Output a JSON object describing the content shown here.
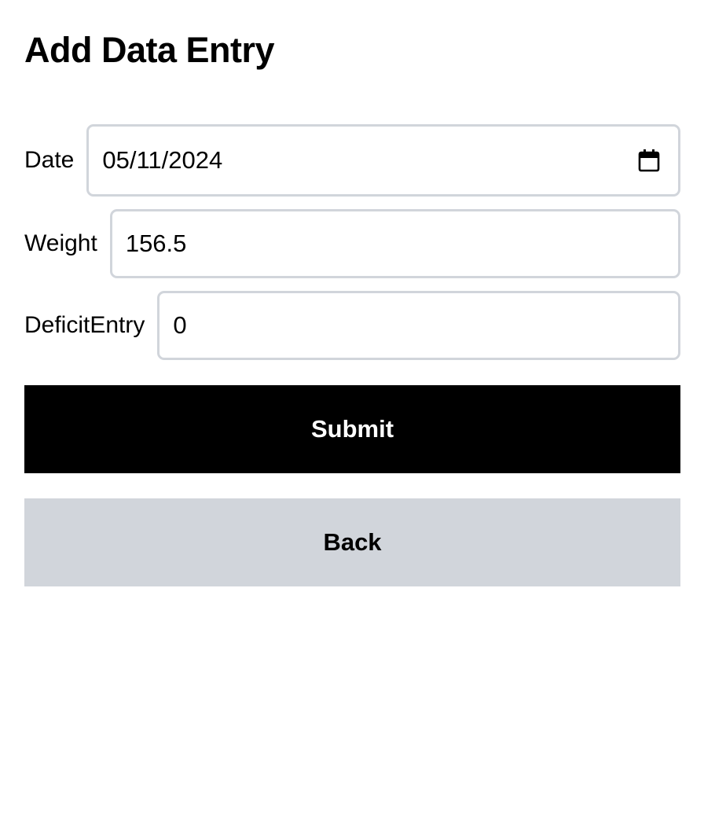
{
  "page": {
    "title": "Add Data Entry"
  },
  "form": {
    "date": {
      "label": "Date",
      "value": "05/11/2024",
      "icon": "calendar-icon"
    },
    "weight": {
      "label": "Weight",
      "value": "156.5"
    },
    "deficit": {
      "label": "DeficitEntry",
      "value": "0"
    }
  },
  "actions": {
    "submit_label": "Submit",
    "back_label": "Back"
  },
  "colors": {
    "primary_button": "#000000",
    "secondary_button": "#d1d5db",
    "input_border": "#d1d5db"
  }
}
